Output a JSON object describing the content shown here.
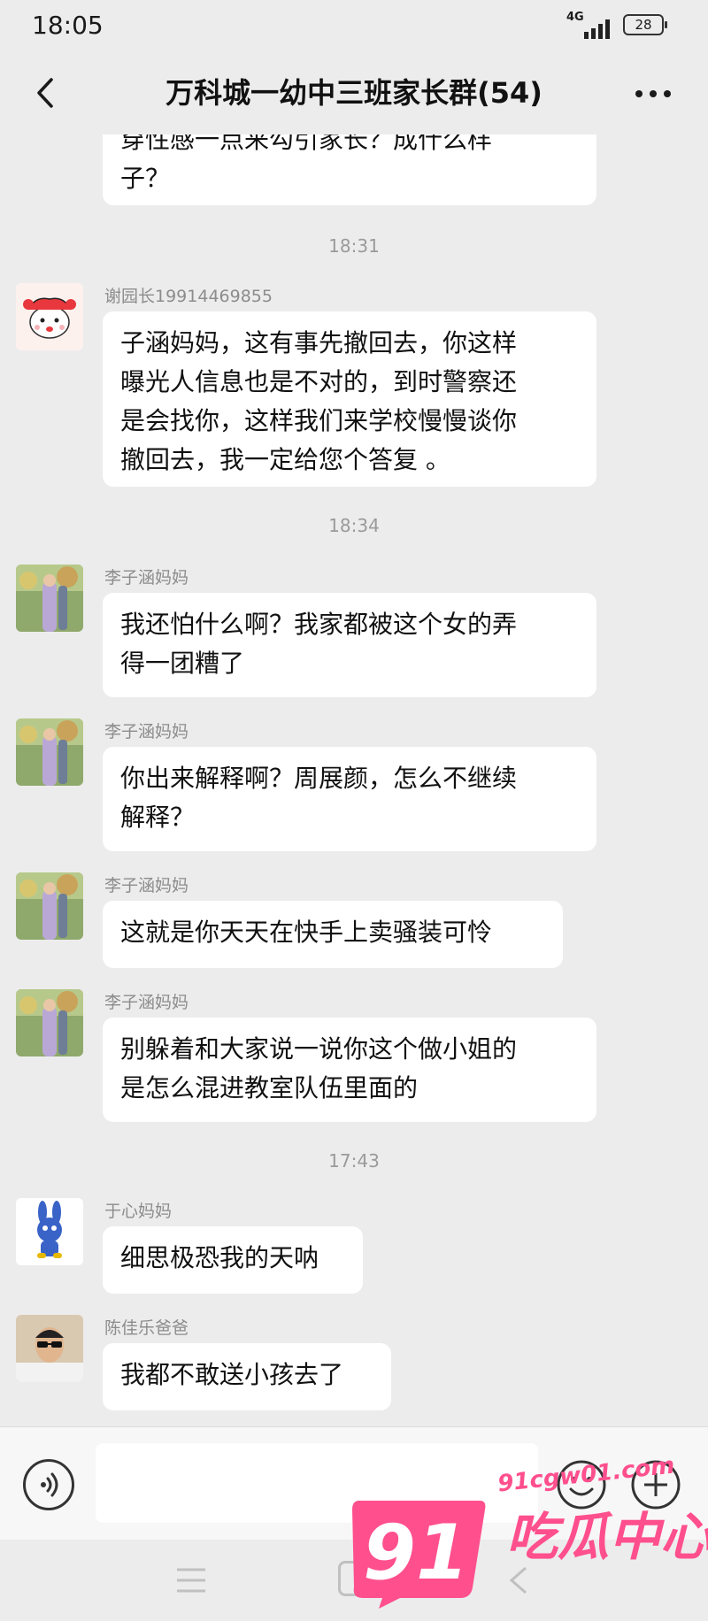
{
  "status_bar": {
    "time": "18:05",
    "network": "4G",
    "battery": "28"
  },
  "header": {
    "title": "万科城一幼中三班家长群(54)"
  },
  "messages": {
    "m0": {
      "text": "穿性感一点来勾引家长？成什么样\n子？"
    },
    "t1": "18:31",
    "m1": {
      "sender": "谢园长19914469855",
      "text": "子涵妈妈，这有事先撤回去，你这样\n曝光人信息也是不对的，到时警察还\n是会找你，这样我们来学校慢慢谈你\n撤回去，我一定给您个答复 。"
    },
    "t2": "18:34",
    "m2": {
      "sender": "李子涵妈妈",
      "text": "我还怕什么啊？我家都被这个女的弄\n得一团糟了"
    },
    "m3": {
      "sender": "李子涵妈妈",
      "text": "你出来解释啊？周展颜，怎么不继续\n解释？"
    },
    "m4": {
      "sender": "李子涵妈妈",
      "text": "这就是你天天在快手上卖骚装可怜"
    },
    "m5": {
      "sender": "李子涵妈妈",
      "text": "别躲着和大家说一说你这个做小姐的\n是怎么混进教室队伍里面的"
    },
    "t3": "17:43",
    "m6": {
      "sender": "于心妈妈",
      "text": "细思极恐我的天呐"
    },
    "m7": {
      "sender": "陈佳乐爸爸",
      "text": "我都不敢送小孩去了"
    }
  },
  "input_bar": {
    "value": "",
    "placeholder": ""
  },
  "icons": {
    "back": "chevron-left-icon",
    "more": "more-dots-icon",
    "voice": "voice-icon",
    "emoji": "emoji-icon",
    "plus": "plus-icon"
  },
  "watermark": {
    "number": "91",
    "url": "91cgw01.com",
    "brand": "吃瓜中心"
  },
  "colors": {
    "background": "#ececec",
    "bubble": "#ffffff",
    "watermark": "#ff4f8d"
  }
}
